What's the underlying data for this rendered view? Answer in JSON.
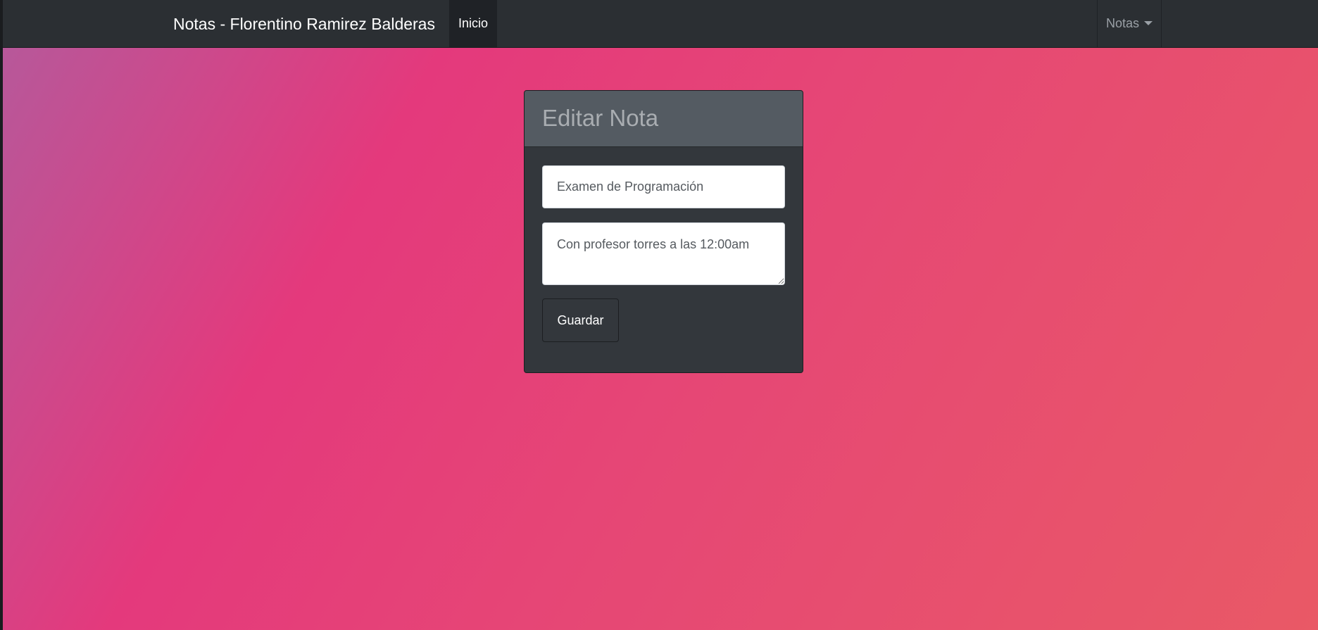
{
  "navbar": {
    "brand": "Notas - Florentino Ramirez Balderas",
    "home_label": "Inicio",
    "notes_menu_label": "Notas"
  },
  "card": {
    "title": "Editar Nota"
  },
  "form": {
    "title_value": "Examen de Programación",
    "description_value": "Con profesor torres a las 12:00am",
    "save_label": "Guardar"
  },
  "icons": {
    "dropdown": "chevron-down-icon"
  },
  "colors": {
    "navbar_background": "#2b2f33",
    "card_background": "#33373c",
    "card_header_background": "#545b62",
    "page_gradient": [
      "#b45a9c",
      "#e4397c",
      "#e64775",
      "#e95966"
    ]
  }
}
